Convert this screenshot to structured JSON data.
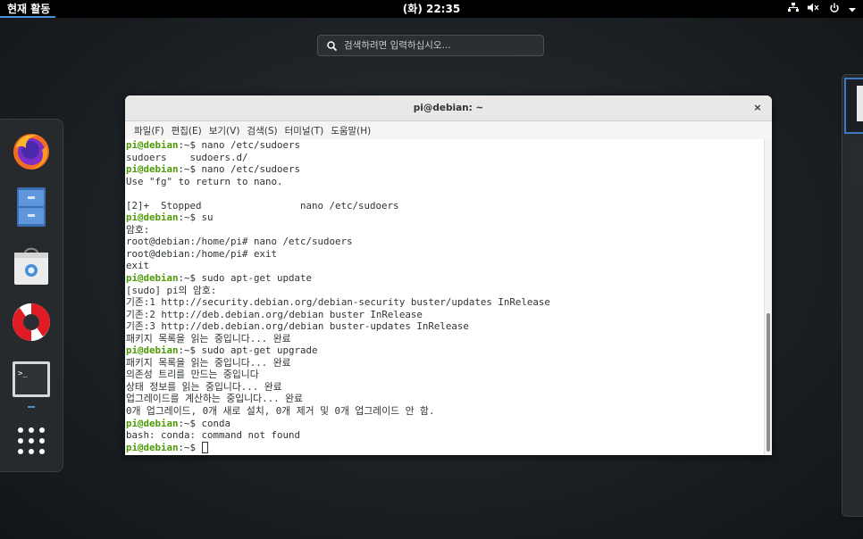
{
  "topbar": {
    "activities": "현재 활동",
    "clock": "(화) 22:35",
    "tray": {
      "network_icon": "network-wired-icon",
      "volume_icon": "volume-muted-icon",
      "power_icon": "power-icon",
      "menu_icon": "chevron-down-icon"
    }
  },
  "search": {
    "placeholder": "검색하려면 입력하십시오..."
  },
  "dash": {
    "items": [
      {
        "name": "firefox",
        "icon": "firefox-icon"
      },
      {
        "name": "files",
        "icon": "file-cabinet-icon"
      },
      {
        "name": "software",
        "icon": "software-bag-icon"
      },
      {
        "name": "help",
        "icon": "lifebuoy-icon"
      },
      {
        "name": "terminal",
        "icon": "terminal-icon"
      },
      {
        "name": "app-grid",
        "icon": "app-grid-icon"
      }
    ]
  },
  "window": {
    "title": "pi@debian: ~",
    "close": "×",
    "menu": [
      "파일(F)",
      "편집(E)",
      "보기(V)",
      "검색(S)",
      "터미널(T)",
      "도움말(H)"
    ]
  },
  "terminal": {
    "prompt_user": "pi@debian",
    "lines": [
      {
        "type": "prompt",
        "cmd": "nano /etc/sudoers"
      },
      {
        "type": "out",
        "text": "sudoers    sudoers.d/"
      },
      {
        "type": "prompt",
        "cmd": "nano /etc/sudoers"
      },
      {
        "type": "out",
        "text": "Use \"fg\" to return to nano."
      },
      {
        "type": "out",
        "text": ""
      },
      {
        "type": "out",
        "text": "[2]+  Stopped                 nano /etc/sudoers"
      },
      {
        "type": "prompt",
        "cmd": "su"
      },
      {
        "type": "out",
        "text": "암호:"
      },
      {
        "type": "out",
        "text": "root@debian:/home/pi# nano /etc/sudoers"
      },
      {
        "type": "out",
        "text": "root@debian:/home/pi# exit"
      },
      {
        "type": "out",
        "text": "exit"
      },
      {
        "type": "prompt",
        "cmd": "sudo apt-get update"
      },
      {
        "type": "out",
        "text": "[sudo] pi의 암호:"
      },
      {
        "type": "out",
        "text": "기존:1 http://security.debian.org/debian-security buster/updates InRelease"
      },
      {
        "type": "out",
        "text": "기존:2 http://deb.debian.org/debian buster InRelease"
      },
      {
        "type": "out",
        "text": "기존:3 http://deb.debian.org/debian buster-updates InRelease"
      },
      {
        "type": "out",
        "text": "패키지 목록을 읽는 중입니다... 완료"
      },
      {
        "type": "prompt",
        "cmd": "sudo apt-get upgrade"
      },
      {
        "type": "out",
        "text": "패키지 목록을 읽는 중입니다... 완료"
      },
      {
        "type": "out",
        "text": "의존성 트리를 만드는 중입니다"
      },
      {
        "type": "out",
        "text": "상태 정보를 읽는 중입니다... 완료"
      },
      {
        "type": "out",
        "text": "업그레이드를 계산하는 중입니다... 완료"
      },
      {
        "type": "out",
        "text": "0개 업그레이드, 0개 새로 설치, 0개 제거 및 0개 업그레이드 안 함."
      },
      {
        "type": "prompt",
        "cmd": "conda"
      },
      {
        "type": "out",
        "text": "bash: conda: command not found"
      },
      {
        "type": "prompt",
        "cmd": "",
        "cursor": true
      }
    ]
  }
}
